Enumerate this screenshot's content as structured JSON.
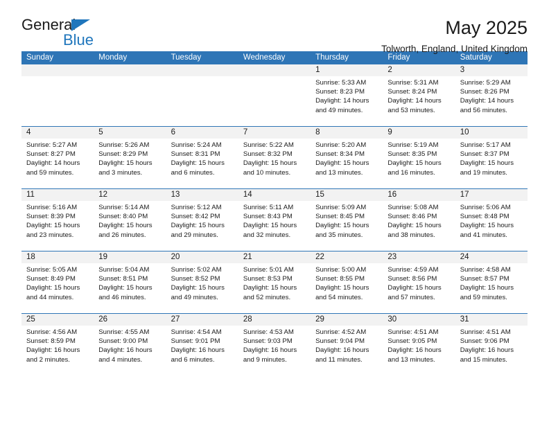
{
  "brand": {
    "logo_text_top": "General",
    "logo_text_bottom": "Blue",
    "logo_icon": "blue-triangle-icon",
    "accent_color": "#2e75b6",
    "logo_blue": "#1f76bc"
  },
  "header": {
    "month_title": "May 2025",
    "location": "Tolworth, England, United Kingdom"
  },
  "calendar": {
    "weekday_headers": [
      "Sunday",
      "Monday",
      "Tuesday",
      "Wednesday",
      "Thursday",
      "Friday",
      "Saturday"
    ],
    "header_bg": "#2e75b6",
    "day_band_bg": "#f2f2f2",
    "row_separator_color": "#2e75b6",
    "weeks": [
      [
        {
          "day": "",
          "empty": true
        },
        {
          "day": "",
          "empty": true
        },
        {
          "day": "",
          "empty": true
        },
        {
          "day": "",
          "empty": true
        },
        {
          "day": "1",
          "sunrise": "Sunrise: 5:33 AM",
          "sunset": "Sunset: 8:23 PM",
          "daylight": "Daylight: 14 hours and 49 minutes."
        },
        {
          "day": "2",
          "sunrise": "Sunrise: 5:31 AM",
          "sunset": "Sunset: 8:24 PM",
          "daylight": "Daylight: 14 hours and 53 minutes."
        },
        {
          "day": "3",
          "sunrise": "Sunrise: 5:29 AM",
          "sunset": "Sunset: 8:26 PM",
          "daylight": "Daylight: 14 hours and 56 minutes."
        }
      ],
      [
        {
          "day": "4",
          "sunrise": "Sunrise: 5:27 AM",
          "sunset": "Sunset: 8:27 PM",
          "daylight": "Daylight: 14 hours and 59 minutes."
        },
        {
          "day": "5",
          "sunrise": "Sunrise: 5:26 AM",
          "sunset": "Sunset: 8:29 PM",
          "daylight": "Daylight: 15 hours and 3 minutes."
        },
        {
          "day": "6",
          "sunrise": "Sunrise: 5:24 AM",
          "sunset": "Sunset: 8:31 PM",
          "daylight": "Daylight: 15 hours and 6 minutes."
        },
        {
          "day": "7",
          "sunrise": "Sunrise: 5:22 AM",
          "sunset": "Sunset: 8:32 PM",
          "daylight": "Daylight: 15 hours and 10 minutes."
        },
        {
          "day": "8",
          "sunrise": "Sunrise: 5:20 AM",
          "sunset": "Sunset: 8:34 PM",
          "daylight": "Daylight: 15 hours and 13 minutes."
        },
        {
          "day": "9",
          "sunrise": "Sunrise: 5:19 AM",
          "sunset": "Sunset: 8:35 PM",
          "daylight": "Daylight: 15 hours and 16 minutes."
        },
        {
          "day": "10",
          "sunrise": "Sunrise: 5:17 AM",
          "sunset": "Sunset: 8:37 PM",
          "daylight": "Daylight: 15 hours and 19 minutes."
        }
      ],
      [
        {
          "day": "11",
          "sunrise": "Sunrise: 5:16 AM",
          "sunset": "Sunset: 8:39 PM",
          "daylight": "Daylight: 15 hours and 23 minutes."
        },
        {
          "day": "12",
          "sunrise": "Sunrise: 5:14 AM",
          "sunset": "Sunset: 8:40 PM",
          "daylight": "Daylight: 15 hours and 26 minutes."
        },
        {
          "day": "13",
          "sunrise": "Sunrise: 5:12 AM",
          "sunset": "Sunset: 8:42 PM",
          "daylight": "Daylight: 15 hours and 29 minutes."
        },
        {
          "day": "14",
          "sunrise": "Sunrise: 5:11 AM",
          "sunset": "Sunset: 8:43 PM",
          "daylight": "Daylight: 15 hours and 32 minutes."
        },
        {
          "day": "15",
          "sunrise": "Sunrise: 5:09 AM",
          "sunset": "Sunset: 8:45 PM",
          "daylight": "Daylight: 15 hours and 35 minutes."
        },
        {
          "day": "16",
          "sunrise": "Sunrise: 5:08 AM",
          "sunset": "Sunset: 8:46 PM",
          "daylight": "Daylight: 15 hours and 38 minutes."
        },
        {
          "day": "17",
          "sunrise": "Sunrise: 5:06 AM",
          "sunset": "Sunset: 8:48 PM",
          "daylight": "Daylight: 15 hours and 41 minutes."
        }
      ],
      [
        {
          "day": "18",
          "sunrise": "Sunrise: 5:05 AM",
          "sunset": "Sunset: 8:49 PM",
          "daylight": "Daylight: 15 hours and 44 minutes."
        },
        {
          "day": "19",
          "sunrise": "Sunrise: 5:04 AM",
          "sunset": "Sunset: 8:51 PM",
          "daylight": "Daylight: 15 hours and 46 minutes."
        },
        {
          "day": "20",
          "sunrise": "Sunrise: 5:02 AM",
          "sunset": "Sunset: 8:52 PM",
          "daylight": "Daylight: 15 hours and 49 minutes."
        },
        {
          "day": "21",
          "sunrise": "Sunrise: 5:01 AM",
          "sunset": "Sunset: 8:53 PM",
          "daylight": "Daylight: 15 hours and 52 minutes."
        },
        {
          "day": "22",
          "sunrise": "Sunrise: 5:00 AM",
          "sunset": "Sunset: 8:55 PM",
          "daylight": "Daylight: 15 hours and 54 minutes."
        },
        {
          "day": "23",
          "sunrise": "Sunrise: 4:59 AM",
          "sunset": "Sunset: 8:56 PM",
          "daylight": "Daylight: 15 hours and 57 minutes."
        },
        {
          "day": "24",
          "sunrise": "Sunrise: 4:58 AM",
          "sunset": "Sunset: 8:57 PM",
          "daylight": "Daylight: 15 hours and 59 minutes."
        }
      ],
      [
        {
          "day": "25",
          "sunrise": "Sunrise: 4:56 AM",
          "sunset": "Sunset: 8:59 PM",
          "daylight": "Daylight: 16 hours and 2 minutes."
        },
        {
          "day": "26",
          "sunrise": "Sunrise: 4:55 AM",
          "sunset": "Sunset: 9:00 PM",
          "daylight": "Daylight: 16 hours and 4 minutes."
        },
        {
          "day": "27",
          "sunrise": "Sunrise: 4:54 AM",
          "sunset": "Sunset: 9:01 PM",
          "daylight": "Daylight: 16 hours and 6 minutes."
        },
        {
          "day": "28",
          "sunrise": "Sunrise: 4:53 AM",
          "sunset": "Sunset: 9:03 PM",
          "daylight": "Daylight: 16 hours and 9 minutes."
        },
        {
          "day": "29",
          "sunrise": "Sunrise: 4:52 AM",
          "sunset": "Sunset: 9:04 PM",
          "daylight": "Daylight: 16 hours and 11 minutes."
        },
        {
          "day": "30",
          "sunrise": "Sunrise: 4:51 AM",
          "sunset": "Sunset: 9:05 PM",
          "daylight": "Daylight: 16 hours and 13 minutes."
        },
        {
          "day": "31",
          "sunrise": "Sunrise: 4:51 AM",
          "sunset": "Sunset: 9:06 PM",
          "daylight": "Daylight: 16 hours and 15 minutes."
        }
      ]
    ]
  }
}
